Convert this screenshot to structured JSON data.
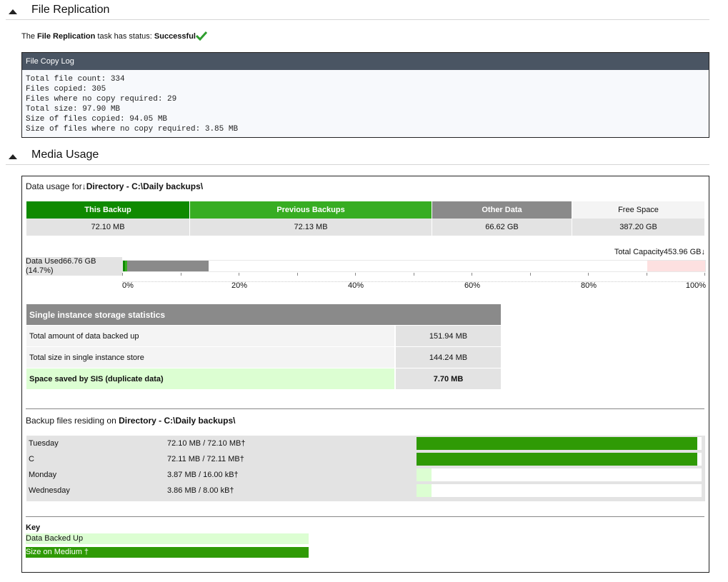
{
  "file_replication": {
    "title": "File Replication",
    "status_prefix": "The",
    "task_name": "File Replication",
    "status_mid": "task has status:",
    "status": "Successful",
    "log_title": "File Copy Log",
    "log_lines": [
      "Total file count: 334",
      "Files copied: 305",
      "Files where no copy required: 29",
      "Total size: 97.90 MB",
      "Size of files copied: 94.05 MB",
      "Size of files where no copy required: 3.85 MB"
    ]
  },
  "media_usage": {
    "title": "Media Usage",
    "usage_prefix": "Data usage for",
    "location": "Directory - C:\\Daily backups\\",
    "summary": {
      "headers": [
        "This Backup",
        "Previous Backups",
        "Other Data",
        "Free Space"
      ],
      "values": [
        "72.10 MB",
        "72.13 MB",
        "66.62 GB",
        "387.20 GB"
      ]
    },
    "total_capacity": "Total Capacity453.96 GB",
    "data_used_line1": "Data Used66.76 GB",
    "data_used_line2": "(14.7%)",
    "usage_fractions": {
      "this_backup": 0.0002,
      "previous_backups": 0.0002,
      "other_data": 0.147,
      "reserved_warning_start": 0.9
    },
    "axis_labels": [
      "0%",
      "20%",
      "40%",
      "60%",
      "80%",
      "100%"
    ],
    "sis": {
      "title": "Single instance storage statistics",
      "rows": [
        {
          "label": "Total amount of data backed up",
          "value": "151.94 MB"
        },
        {
          "label": "Total size in single instance store",
          "value": "144.24 MB"
        },
        {
          "label": "Space saved by SIS (duplicate data)",
          "value": "7.70 MB"
        }
      ]
    },
    "files_prefix": "Backup files residing on",
    "files_location": "Directory - C:\\Daily backups\\",
    "files": [
      {
        "name": "Tuesday",
        "value": "72.10 MB / 72.10 MB†",
        "fraction_up": 1.0,
        "fraction_medium": 1.0
      },
      {
        "name": "C",
        "value": "72.11 MB / 72.11 MB†",
        "fraction_up": 1.0,
        "fraction_medium": 1.0
      },
      {
        "name": "Monday",
        "value": "3.87 MB / 16.00 kB†",
        "fraction_up": 0.054,
        "fraction_medium": 0.0002
      },
      {
        "name": "Wednesday",
        "value": "3.86 MB / 8.00 kB†",
        "fraction_up": 0.054,
        "fraction_medium": 0.0001
      }
    ],
    "key_title": "Key",
    "key_backed_up": "Data Backed Up",
    "key_medium": "Size on Medium †"
  },
  "colors": {
    "this_backup": "#0f8a00",
    "previous_backups": "#37ad22",
    "other_data": "#8a8a8a",
    "free_space": "#f4f4f4",
    "data_backed_up": "#dcfed2",
    "size_on_medium": "#2f9a05",
    "success_check": "#2e9e2e"
  },
  "icons": {
    "collapse": "triangle-up-icon",
    "status": "checkmark-icon",
    "location": "down-arrow-glyph"
  }
}
